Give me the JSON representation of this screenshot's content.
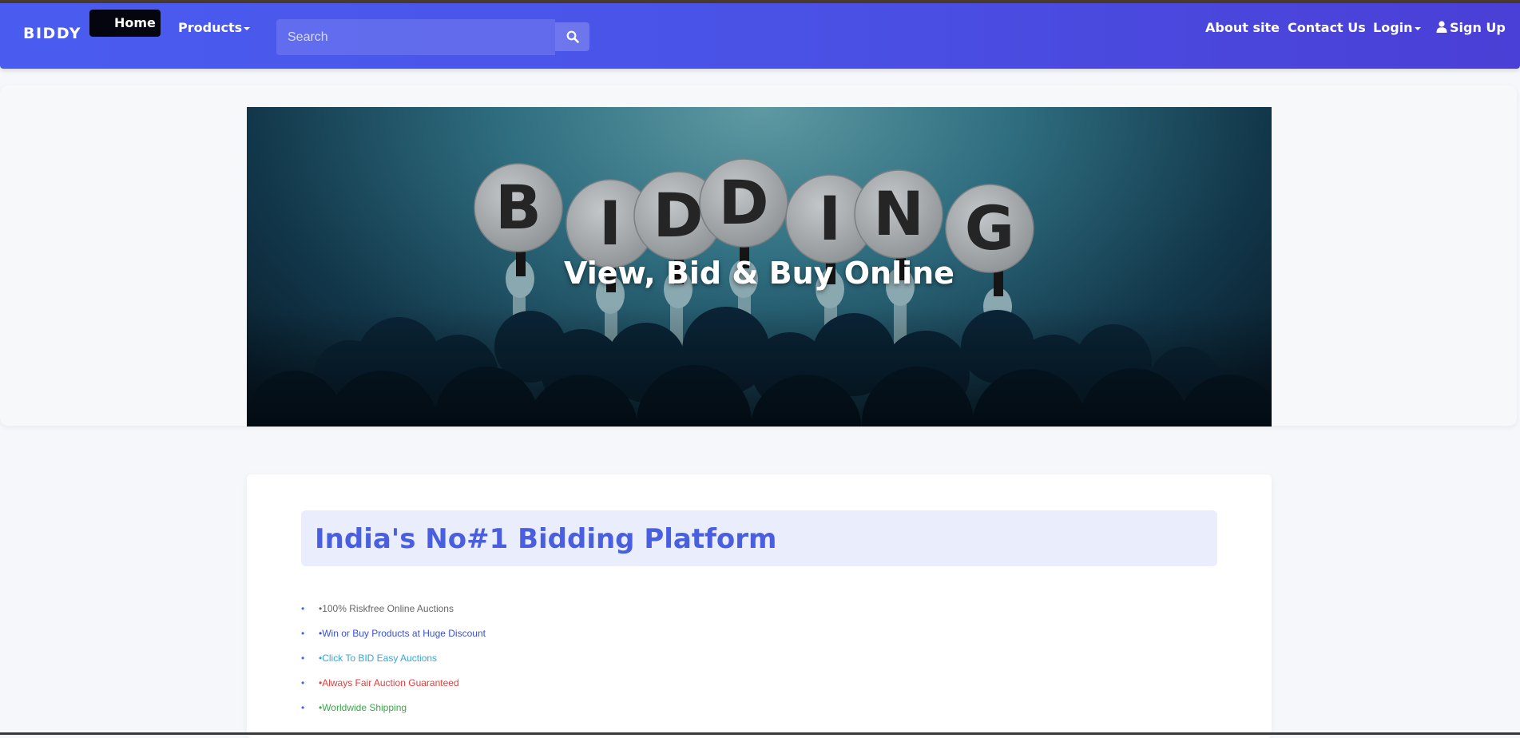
{
  "navbar": {
    "brand": "BIDDY",
    "home_label": "Home",
    "products_label": "Products",
    "search_placeholder": "Search",
    "about_label": "About site",
    "contact_label": "Contact Us",
    "login_label": "Login",
    "signup_label": "Sign Up"
  },
  "hero": {
    "sign_letters": [
      "B",
      "I",
      "D",
      "D",
      "I",
      "N",
      "G"
    ],
    "title": "View, Bid & Buy Online"
  },
  "main": {
    "headline": "India's No#1 Bidding Platform",
    "features": [
      {
        "text": "•100% Riskfree Online Auctions",
        "color": "#666666"
      },
      {
        "text": "•Win or Buy Products at Huge Discount",
        "color": "#3a4fd8"
      },
      {
        "text": "•Click To BID Easy Auctions",
        "color": "#35a8d8"
      },
      {
        "text": "•Always Fair Auction Guaranteed",
        "color": "#e83a3a"
      },
      {
        "text": "•Worldwide Shipping",
        "color": "#3aa84a"
      }
    ]
  },
  "colors": {
    "navbar_gradient_start": "#4a5cf0",
    "navbar_gradient_end": "#4a3fd6",
    "headline": "#4a5fe0",
    "headline_bg": "#eaeefc"
  }
}
